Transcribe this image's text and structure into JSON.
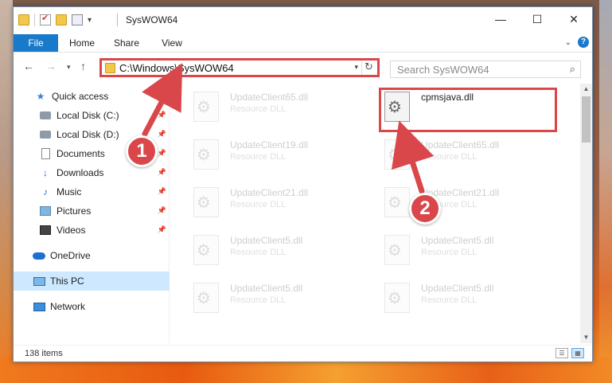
{
  "window": {
    "title": "SysWOW64",
    "caption": {
      "minimize": "—",
      "maximize": "☐",
      "close": "✕"
    }
  },
  "ribbon": {
    "tabs": [
      "File",
      "Home",
      "Share",
      "View"
    ],
    "help": "?"
  },
  "navigation": {
    "address": "C:\\Windows\\SysWOW64",
    "search_placeholder": "Search SysWOW64"
  },
  "sidebar": {
    "items": [
      {
        "label": "Quick access",
        "icon": "star-icon",
        "pinned": false
      },
      {
        "label": "Local Disk (C:)",
        "icon": "drive-icon",
        "pinned": true
      },
      {
        "label": "Local Disk (D:)",
        "icon": "drive-icon",
        "pinned": true
      },
      {
        "label": "Documents",
        "icon": "documents-icon",
        "pinned": true
      },
      {
        "label": "Downloads",
        "icon": "download-icon",
        "pinned": true
      },
      {
        "label": "Music",
        "icon": "music-icon",
        "pinned": true
      },
      {
        "label": "Pictures",
        "icon": "pictures-icon",
        "pinned": true
      },
      {
        "label": "Videos",
        "icon": "videos-icon",
        "pinned": true
      },
      {
        "label": "OneDrive",
        "icon": "cloud-icon",
        "pinned": false
      },
      {
        "label": "This PC",
        "icon": "computer-icon",
        "pinned": false,
        "selected": true
      },
      {
        "label": "Network",
        "icon": "network-icon",
        "pinned": false
      }
    ]
  },
  "files": {
    "left_column": [
      {
        "name": "UpdateClient65.dll",
        "type": "Resource DLL"
      },
      {
        "name": "UpdateClient19.dll",
        "type": "Resource DLL"
      },
      {
        "name": "UpdateClient21.dll",
        "type": "Resource DLL"
      },
      {
        "name": "UpdateClient5.dll",
        "type": "Resource DLL"
      },
      {
        "name": "UpdateClient5.dll",
        "type": "Resource DLL"
      }
    ],
    "right_column": [
      {
        "name": "cpmsjava.dll",
        "type": "",
        "highlighted": true
      },
      {
        "name": "UpdateClient65.dll",
        "type": "Resource DLL"
      },
      {
        "name": "UpdateClient21.dll",
        "type": "Resource DLL"
      },
      {
        "name": "UpdateClient5.dll",
        "type": "Resource DLL"
      },
      {
        "name": "UpdateClient5.dll",
        "type": "Resource DLL"
      }
    ]
  },
  "status": {
    "item_count": "138 items"
  },
  "callouts": {
    "step1": "1",
    "step2": "2",
    "color": "#d9474b"
  }
}
